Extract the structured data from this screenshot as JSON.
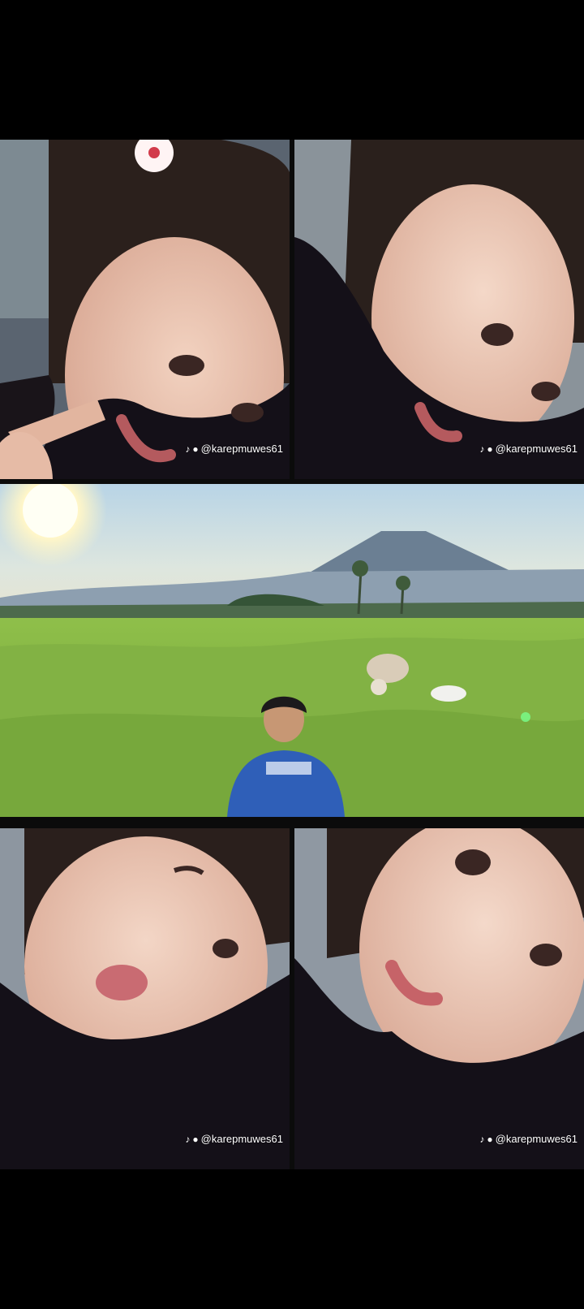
{
  "watermark": {
    "handle": "@karepmuwes61",
    "icon": "tiktok-icon"
  },
  "tiles": [
    {
      "id": "selfie-peace-sign",
      "description": "girl selfie with peace sign and flower hair clip"
    },
    {
      "id": "selfie-smile",
      "description": "girl selfie smiling"
    },
    {
      "id": "landscape",
      "description": "boy in blue shirt sitting in green field with goats, mountain and sun behind"
    },
    {
      "id": "selfie-pout",
      "description": "girl selfie pouting with one eye closed"
    },
    {
      "id": "selfie-closeup",
      "description": "girl selfie close-up"
    }
  ],
  "colors": {
    "background": "#000000",
    "grass": "#7cb342",
    "sky": "#cfe0e8",
    "shirt": "#2f5fb8"
  }
}
